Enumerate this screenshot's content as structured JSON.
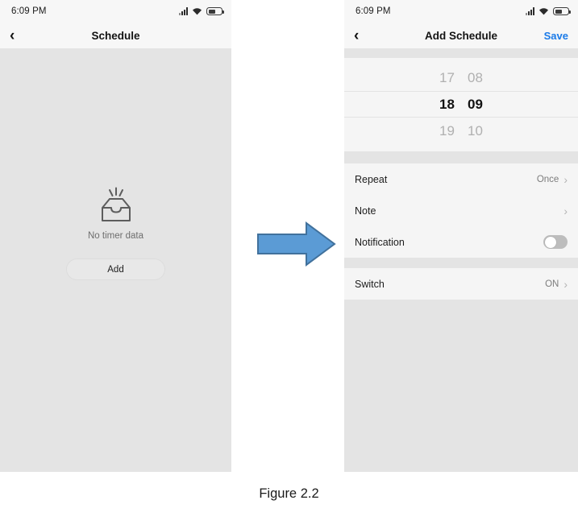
{
  "left_screen": {
    "status": {
      "time": "6:09 PM",
      "icons": [
        "signal-icon",
        "wifi-icon",
        "battery-icon"
      ]
    },
    "nav": {
      "back": "‹",
      "title": "Schedule"
    },
    "empty": {
      "icon": "inbox-icon",
      "text": "No timer data",
      "add_label": "Add"
    }
  },
  "right_screen": {
    "status": {
      "time": "6:09 PM",
      "icons": [
        "signal-icon",
        "wifi-icon",
        "battery-icon"
      ]
    },
    "nav": {
      "back": "‹",
      "title": "Add Schedule",
      "action": "Save",
      "action_color": "#1a7ae8"
    },
    "picker": {
      "rows": [
        {
          "hour": "17",
          "minute": "08",
          "selected": false
        },
        {
          "hour": "18",
          "minute": "09",
          "selected": true
        },
        {
          "hour": "19",
          "minute": "10",
          "selected": false
        }
      ]
    },
    "list_group_1": [
      {
        "label": "Repeat",
        "value": "Once",
        "accessory": "chevron"
      },
      {
        "label": "Note",
        "value": "",
        "accessory": "chevron"
      },
      {
        "label": "Notification",
        "value": "",
        "accessory": "toggle",
        "toggle_on": false
      }
    ],
    "list_group_2": [
      {
        "label": "Switch",
        "value": "ON",
        "accessory": "chevron"
      }
    ]
  },
  "arrow": {
    "name": "right-arrow",
    "fill": "#5b9bd5",
    "stroke": "#41719c"
  },
  "caption": {
    "text": "Figure 2.2"
  }
}
